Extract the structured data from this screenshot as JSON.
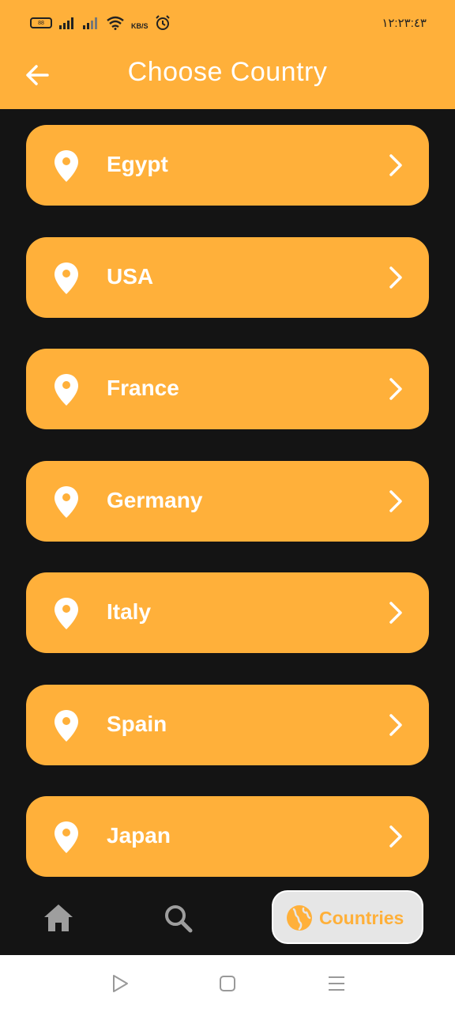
{
  "status_bar": {
    "time": "١٢:٢٣:٤٣",
    "battery_label": "88",
    "network_speed_unit": "KB/S",
    "icons": [
      "battery-icon",
      "signal-icon",
      "signal-icon",
      "wifi-icon",
      "alarm-icon"
    ]
  },
  "header": {
    "title": "Choose Country",
    "back_icon": "arrow-left-icon"
  },
  "countries": [
    {
      "label": "Egypt"
    },
    {
      "label": "USA"
    },
    {
      "label": "France"
    },
    {
      "label": "Germany"
    },
    {
      "label": "Italy"
    },
    {
      "label": "Spain"
    },
    {
      "label": "Japan"
    }
  ],
  "bottom_nav": {
    "items": [
      {
        "icon": "home-icon"
      },
      {
        "icon": "search-icon"
      },
      {
        "icon": "globe-icon",
        "label": "Countries",
        "active": true
      }
    ]
  },
  "system_nav": {
    "icons": [
      "back-triangle-icon",
      "home-square-icon",
      "menu-lines-icon"
    ]
  },
  "colors": {
    "accent": "#FFB03A",
    "background": "#141414",
    "text_on_accent": "#FFFFFF",
    "active_tab_bg": "#E6E6E6"
  }
}
